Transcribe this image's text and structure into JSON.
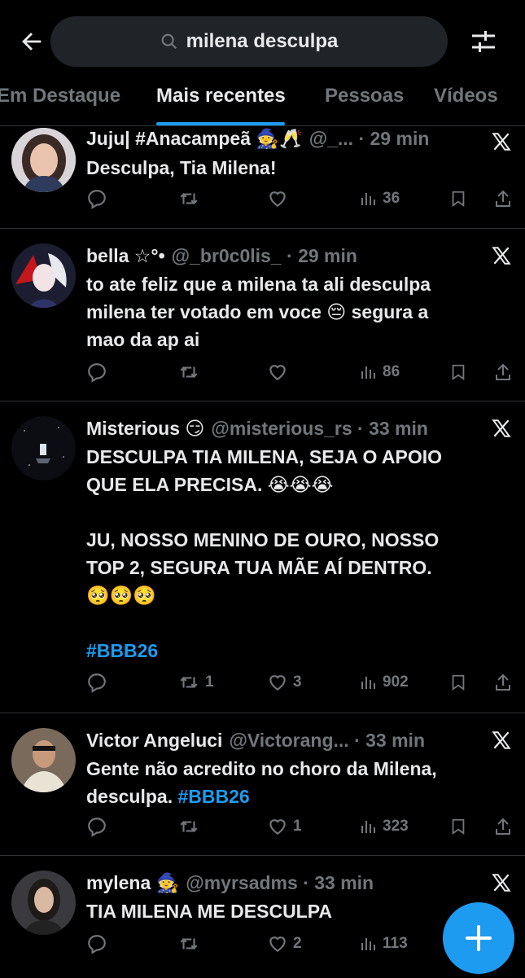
{
  "search": {
    "query": "milena desculpa"
  },
  "tabs": [
    "Em Destaque",
    "Mais recentes",
    "Pessoas",
    "Vídeos"
  ],
  "posts": [
    {
      "name": "Juju| #Anacampeã 🧙🥂",
      "handle": "@_... · 29 min",
      "lines": [
        "Desculpa, Tia Milena!"
      ],
      "stats": {
        "reply": "",
        "repost": "",
        "like": "",
        "views": "36"
      }
    },
    {
      "name": "bella ☆°•",
      "handle": "@_br0c0lis_ · 29 min",
      "lines": [
        "to ate feliz que a milena ta ali desculpa",
        "milena ter votado em voce 😔 segura a",
        "mao da ap ai"
      ],
      "stats": {
        "reply": "",
        "repost": "",
        "like": "",
        "views": "86"
      }
    },
    {
      "name": "Misterious 😏",
      "handle": "@misterious_rs · 33 min",
      "lines": [
        "DESCULPA TIA MILENA, SEJA O APOIO",
        "QUE ELA PRECISA. 😭😭😭",
        "",
        "JU, NOSSO MENINO DE OURO, NOSSO",
        "TOP 2, SEGURA TUA MÃE AÍ DENTRO.",
        "🥺🥺🥺",
        "",
        "#BBB26"
      ],
      "stats": {
        "reply": "",
        "repost": "1",
        "like": "3",
        "views": "902"
      }
    },
    {
      "name": "Victor Angeluci",
      "handle": "@Victorang... · 33 min",
      "lines": [
        "Gente não acredito no choro da Milena,",
        "desculpa."
      ],
      "hashtag": "#BBB26",
      "stats": {
        "reply": "",
        "repost": "",
        "like": "1",
        "views": "323"
      }
    },
    {
      "name": "mylena 🧙",
      "handle": "@myrsadms · 33 min",
      "lines": [
        "TIA MILENA ME DESCULPA"
      ],
      "stats": {
        "reply": "",
        "repost": "",
        "like": "2",
        "views": "113"
      }
    }
  ],
  "colors": {
    "accent": "#1d9bf0",
    "muted": "#71767b",
    "text": "#e7e9ea",
    "bg": "#000000"
  }
}
